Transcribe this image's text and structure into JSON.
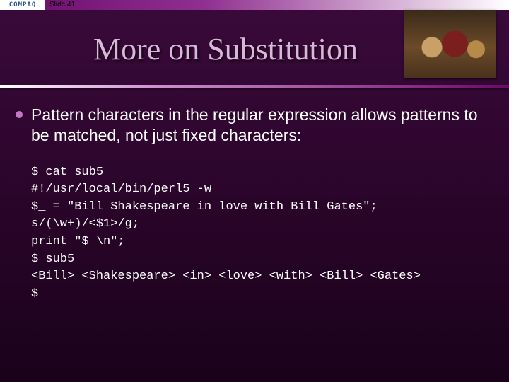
{
  "meta": {
    "logo_text": "COMPAQ",
    "slide_label": "Slide 41"
  },
  "title": "More on Substitution",
  "bullets": [
    "Pattern characters in the regular expression allows patterns to be matched, not just fixed characters:"
  ],
  "code_lines": [
    "$ cat sub5",
    "#!/usr/local/bin/perl5 -w",
    "$_ = \"Bill Shakespeare in love with Bill Gates\";",
    "s/(\\w+)/<$1>/g;",
    "print \"$_\\n\";",
    "$ sub5",
    "<Bill> <Shakespeare> <in> <love> <with> <Bill> <Gates>",
    "$"
  ]
}
